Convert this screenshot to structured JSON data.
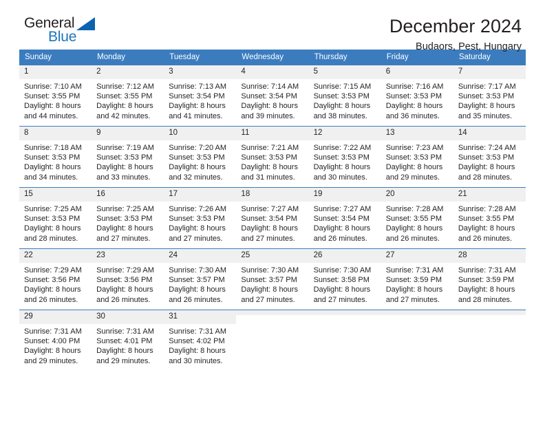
{
  "brand": {
    "name_part1": "General",
    "name_part2": "Blue",
    "logo_icon": "triangle-logo"
  },
  "header": {
    "month_title": "December 2024",
    "location": "Budaors, Pest, Hungary"
  },
  "colors": {
    "header_blue": "#3b7cbf",
    "brand_blue": "#1b75bb",
    "logo_blue": "#0b63ae",
    "daynum_band": "#f0f0f0",
    "text": "#231f20"
  },
  "weekday_headers": [
    "Sunday",
    "Monday",
    "Tuesday",
    "Wednesday",
    "Thursday",
    "Friday",
    "Saturday"
  ],
  "labels": {
    "sunrise_prefix": "Sunrise:",
    "sunset_prefix": "Sunset:",
    "daylight_prefix": "Daylight:"
  },
  "weeks": [
    [
      {
        "day": "1",
        "sunrise": "Sunrise: 7:10 AM",
        "sunset": "Sunset: 3:55 PM",
        "daylight1": "Daylight: 8 hours",
        "daylight2": "and 44 minutes."
      },
      {
        "day": "2",
        "sunrise": "Sunrise: 7:12 AM",
        "sunset": "Sunset: 3:55 PM",
        "daylight1": "Daylight: 8 hours",
        "daylight2": "and 42 minutes."
      },
      {
        "day": "3",
        "sunrise": "Sunrise: 7:13 AM",
        "sunset": "Sunset: 3:54 PM",
        "daylight1": "Daylight: 8 hours",
        "daylight2": "and 41 minutes."
      },
      {
        "day": "4",
        "sunrise": "Sunrise: 7:14 AM",
        "sunset": "Sunset: 3:54 PM",
        "daylight1": "Daylight: 8 hours",
        "daylight2": "and 39 minutes."
      },
      {
        "day": "5",
        "sunrise": "Sunrise: 7:15 AM",
        "sunset": "Sunset: 3:53 PM",
        "daylight1": "Daylight: 8 hours",
        "daylight2": "and 38 minutes."
      },
      {
        "day": "6",
        "sunrise": "Sunrise: 7:16 AM",
        "sunset": "Sunset: 3:53 PM",
        "daylight1": "Daylight: 8 hours",
        "daylight2": "and 36 minutes."
      },
      {
        "day": "7",
        "sunrise": "Sunrise: 7:17 AM",
        "sunset": "Sunset: 3:53 PM",
        "daylight1": "Daylight: 8 hours",
        "daylight2": "and 35 minutes."
      }
    ],
    [
      {
        "day": "8",
        "sunrise": "Sunrise: 7:18 AM",
        "sunset": "Sunset: 3:53 PM",
        "daylight1": "Daylight: 8 hours",
        "daylight2": "and 34 minutes."
      },
      {
        "day": "9",
        "sunrise": "Sunrise: 7:19 AM",
        "sunset": "Sunset: 3:53 PM",
        "daylight1": "Daylight: 8 hours",
        "daylight2": "and 33 minutes."
      },
      {
        "day": "10",
        "sunrise": "Sunrise: 7:20 AM",
        "sunset": "Sunset: 3:53 PM",
        "daylight1": "Daylight: 8 hours",
        "daylight2": "and 32 minutes."
      },
      {
        "day": "11",
        "sunrise": "Sunrise: 7:21 AM",
        "sunset": "Sunset: 3:53 PM",
        "daylight1": "Daylight: 8 hours",
        "daylight2": "and 31 minutes."
      },
      {
        "day": "12",
        "sunrise": "Sunrise: 7:22 AM",
        "sunset": "Sunset: 3:53 PM",
        "daylight1": "Daylight: 8 hours",
        "daylight2": "and 30 minutes."
      },
      {
        "day": "13",
        "sunrise": "Sunrise: 7:23 AM",
        "sunset": "Sunset: 3:53 PM",
        "daylight1": "Daylight: 8 hours",
        "daylight2": "and 29 minutes."
      },
      {
        "day": "14",
        "sunrise": "Sunrise: 7:24 AM",
        "sunset": "Sunset: 3:53 PM",
        "daylight1": "Daylight: 8 hours",
        "daylight2": "and 28 minutes."
      }
    ],
    [
      {
        "day": "15",
        "sunrise": "Sunrise: 7:25 AM",
        "sunset": "Sunset: 3:53 PM",
        "daylight1": "Daylight: 8 hours",
        "daylight2": "and 28 minutes."
      },
      {
        "day": "16",
        "sunrise": "Sunrise: 7:25 AM",
        "sunset": "Sunset: 3:53 PM",
        "daylight1": "Daylight: 8 hours",
        "daylight2": "and 27 minutes."
      },
      {
        "day": "17",
        "sunrise": "Sunrise: 7:26 AM",
        "sunset": "Sunset: 3:53 PM",
        "daylight1": "Daylight: 8 hours",
        "daylight2": "and 27 minutes."
      },
      {
        "day": "18",
        "sunrise": "Sunrise: 7:27 AM",
        "sunset": "Sunset: 3:54 PM",
        "daylight1": "Daylight: 8 hours",
        "daylight2": "and 27 minutes."
      },
      {
        "day": "19",
        "sunrise": "Sunrise: 7:27 AM",
        "sunset": "Sunset: 3:54 PM",
        "daylight1": "Daylight: 8 hours",
        "daylight2": "and 26 minutes."
      },
      {
        "day": "20",
        "sunrise": "Sunrise: 7:28 AM",
        "sunset": "Sunset: 3:55 PM",
        "daylight1": "Daylight: 8 hours",
        "daylight2": "and 26 minutes."
      },
      {
        "day": "21",
        "sunrise": "Sunrise: 7:28 AM",
        "sunset": "Sunset: 3:55 PM",
        "daylight1": "Daylight: 8 hours",
        "daylight2": "and 26 minutes."
      }
    ],
    [
      {
        "day": "22",
        "sunrise": "Sunrise: 7:29 AM",
        "sunset": "Sunset: 3:56 PM",
        "daylight1": "Daylight: 8 hours",
        "daylight2": "and 26 minutes."
      },
      {
        "day": "23",
        "sunrise": "Sunrise: 7:29 AM",
        "sunset": "Sunset: 3:56 PM",
        "daylight1": "Daylight: 8 hours",
        "daylight2": "and 26 minutes."
      },
      {
        "day": "24",
        "sunrise": "Sunrise: 7:30 AM",
        "sunset": "Sunset: 3:57 PM",
        "daylight1": "Daylight: 8 hours",
        "daylight2": "and 26 minutes."
      },
      {
        "day": "25",
        "sunrise": "Sunrise: 7:30 AM",
        "sunset": "Sunset: 3:57 PM",
        "daylight1": "Daylight: 8 hours",
        "daylight2": "and 27 minutes."
      },
      {
        "day": "26",
        "sunrise": "Sunrise: 7:30 AM",
        "sunset": "Sunset: 3:58 PM",
        "daylight1": "Daylight: 8 hours",
        "daylight2": "and 27 minutes."
      },
      {
        "day": "27",
        "sunrise": "Sunrise: 7:31 AM",
        "sunset": "Sunset: 3:59 PM",
        "daylight1": "Daylight: 8 hours",
        "daylight2": "and 27 minutes."
      },
      {
        "day": "28",
        "sunrise": "Sunrise: 7:31 AM",
        "sunset": "Sunset: 3:59 PM",
        "daylight1": "Daylight: 8 hours",
        "daylight2": "and 28 minutes."
      }
    ],
    [
      {
        "day": "29",
        "sunrise": "Sunrise: 7:31 AM",
        "sunset": "Sunset: 4:00 PM",
        "daylight1": "Daylight: 8 hours",
        "daylight2": "and 29 minutes."
      },
      {
        "day": "30",
        "sunrise": "Sunrise: 7:31 AM",
        "sunset": "Sunset: 4:01 PM",
        "daylight1": "Daylight: 8 hours",
        "daylight2": "and 29 minutes."
      },
      {
        "day": "31",
        "sunrise": "Sunrise: 7:31 AM",
        "sunset": "Sunset: 4:02 PM",
        "daylight1": "Daylight: 8 hours",
        "daylight2": "and 30 minutes."
      },
      {
        "day": "",
        "sunrise": "",
        "sunset": "",
        "daylight1": "",
        "daylight2": ""
      },
      {
        "day": "",
        "sunrise": "",
        "sunset": "",
        "daylight1": "",
        "daylight2": ""
      },
      {
        "day": "",
        "sunrise": "",
        "sunset": "",
        "daylight1": "",
        "daylight2": ""
      },
      {
        "day": "",
        "sunrise": "",
        "sunset": "",
        "daylight1": "",
        "daylight2": ""
      }
    ]
  ]
}
